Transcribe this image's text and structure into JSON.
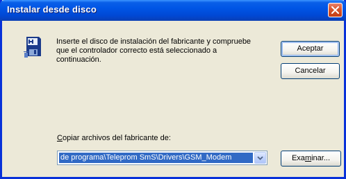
{
  "window": {
    "title": "Instalar desde disco"
  },
  "message": {
    "line1": "Inserte el disco de instalación del fabricante y compruebe",
    "line2": "que el controlador correcto está seleccionado a",
    "line3": "continuación."
  },
  "buttons": {
    "accept_label": "Aceptar",
    "cancel_label": "Cancelar",
    "browse_label_pre": "Exa",
    "browse_label_mnemonic": "m",
    "browse_label_post": "inar..."
  },
  "copy": {
    "label_mnemonic": "C",
    "label_rest": "opiar archivos del fabricante de:",
    "path_value": "de programa\\Teleprom SmS\\Drivers\\GSM_Modem"
  },
  "icons": {
    "titlebar_close": "close-icon",
    "disk": "install-disk-icon",
    "dropdown": "chevron-down-icon"
  },
  "colors": {
    "titlebar": "#0055e5",
    "dialog_bg": "#ece9d8",
    "close_button": "#d8542b",
    "selection": "#316ac5"
  }
}
